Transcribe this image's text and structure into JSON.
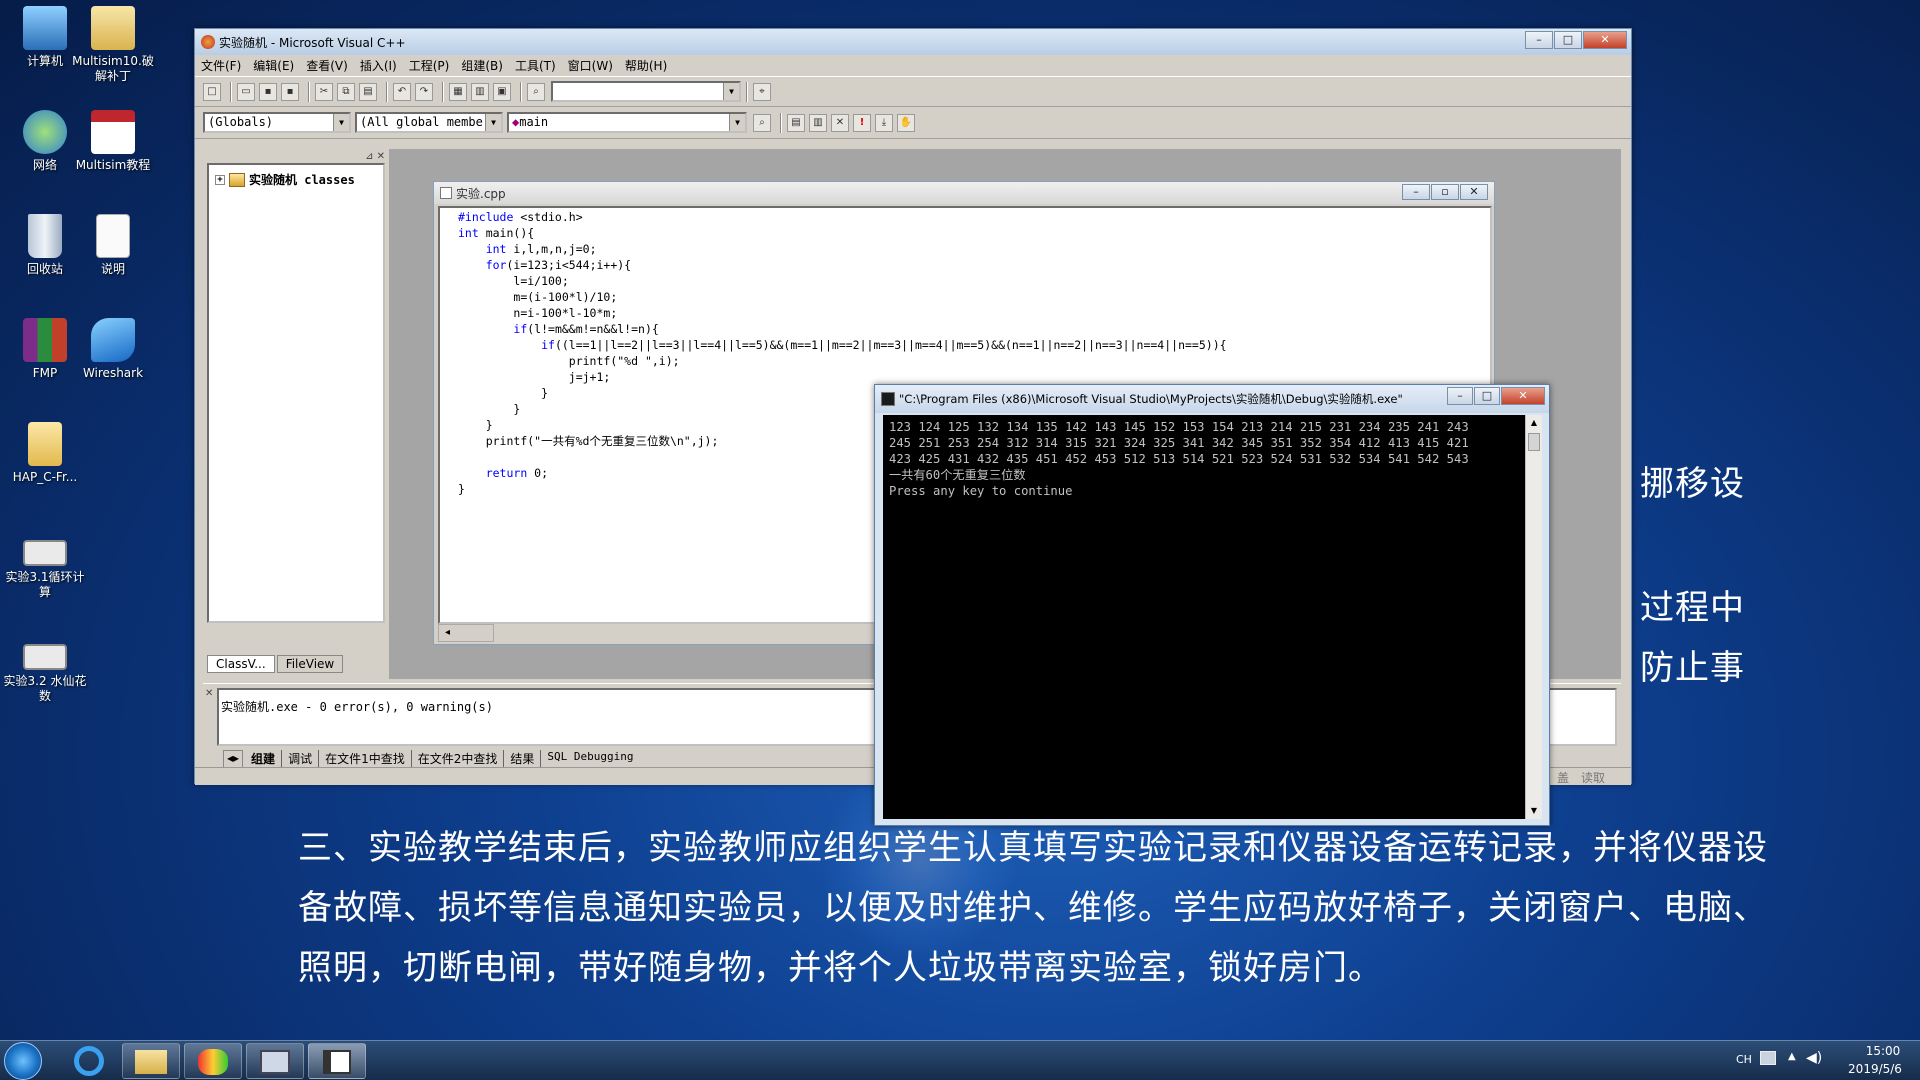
{
  "desktop": {
    "icons": [
      {
        "label": "计算机"
      },
      {
        "label": "Multisim10.破解补丁"
      },
      {
        "label": "网络"
      },
      {
        "label": "Multisim教程"
      },
      {
        "label": "回收站"
      },
      {
        "label": "说明"
      },
      {
        "label": "FMP"
      },
      {
        "label": "Wireshark"
      },
      {
        "label": "HAP_C-Fr..."
      },
      {
        "label": "实验3.1循环计算"
      },
      {
        "label": "实验3.2 水仙花数"
      }
    ],
    "wallpaper_text": {
      "right1": "挪移设",
      "right2": "过程中",
      "right3": "防止事",
      "line1": "三、实验教学结束后，实验教师应组织学生认真填写实验记录和仪器设备运转记录，并将仪器设",
      "line2": "备故障、损坏等信息通知实验员，以便及时维护、维修。学生应码放好椅子，关闭窗户、电脑、",
      "line3": "照明，切断电闸，带好随身物，并将个人垃圾带离实验室，锁好房门。"
    }
  },
  "vc_window": {
    "title": "实验随机 - Microsoft Visual C++",
    "menu": [
      "文件(F)",
      "编辑(E)",
      "查看(V)",
      "插入(I)",
      "工程(P)",
      "组建(B)",
      "工具(T)",
      "窗口(W)",
      "帮助(H)"
    ],
    "combos": {
      "globals": "(Globals)",
      "members": "(All global members",
      "function": "main"
    },
    "workspace": {
      "tree_root": "实验随机 classes",
      "tab_class": "ClassV...",
      "tab_file": "FileView"
    },
    "editor": {
      "title": "实验.cpp",
      "lines": [
        {
          "kw": "#include",
          "rest": " <stdio.h>"
        },
        {
          "kw": "int",
          "rest": " main(){"
        },
        {
          "indent": "    ",
          "kw": "int",
          "rest": " i,l,m,n,j=0;"
        },
        {
          "indent": "    ",
          "kw": "for",
          "rest": "(i=123;i<544;i++){"
        },
        {
          "indent": "        ",
          "kw": "",
          "rest": "l=i/100;"
        },
        {
          "indent": "        ",
          "kw": "",
          "rest": "m=(i-100*l)/10;"
        },
        {
          "indent": "        ",
          "kw": "",
          "rest": "n=i-100*l-10*m;"
        },
        {
          "indent": "        ",
          "kw": "if",
          "rest": "(l!=m&&m!=n&&l!=n){"
        },
        {
          "indent": "            ",
          "kw": "if",
          "rest": "((l==1||l==2||l==3||l==4||l==5)&&(m==1||m==2||m==3||m==4||m==5)&&(n==1||n==2||n==3||n==4||n==5)){"
        },
        {
          "indent": "                ",
          "kw": "",
          "rest": "printf(\"%d \",i);"
        },
        {
          "indent": "                ",
          "kw": "",
          "rest": "j=j+1;"
        },
        {
          "indent": "            ",
          "kw": "",
          "rest": "}"
        },
        {
          "indent": "        ",
          "kw": "",
          "rest": "}"
        },
        {
          "indent": "    ",
          "kw": "",
          "rest": "}"
        },
        {
          "indent": "    ",
          "kw": "",
          "rest": "printf(\"一共有%d个无重复三位数\\n\",j);"
        },
        {
          "indent": "",
          "kw": "",
          "rest": ""
        },
        {
          "indent": "    ",
          "kw": "return",
          "rest": " 0;"
        },
        {
          "indent": "",
          "kw": "",
          "rest": "}"
        }
      ]
    },
    "output": {
      "text": "实验随机.exe - 0 error(s), 0 warning(s)",
      "tabs": [
        "组建",
        "调试",
        "在文件1中查找",
        "在文件2中查找",
        "结果",
        "SQL Debugging"
      ]
    },
    "status": [
      "盖",
      "读取"
    ]
  },
  "console_window": {
    "title": "\"C:\\Program Files (x86)\\Microsoft Visual Studio\\MyProjects\\实验随机\\Debug\\实验随机.exe\"",
    "lines": [
      "123 124 125 132 134 135 142 143 145 152 153 154 213 214 215 231 234 235 241 243",
      "245 251 253 254 312 314 315 321 324 325 341 342 345 351 352 354 412 413 415 421",
      "423 425 431 432 435 451 452 453 512 513 514 521 523 524 531 532 534 541 542 543",
      "一共有60个无重复三位数",
      "Press any key to continue"
    ]
  },
  "taskbar": {
    "lang": "CH",
    "time": "15:00",
    "date": "2019/5/6"
  }
}
